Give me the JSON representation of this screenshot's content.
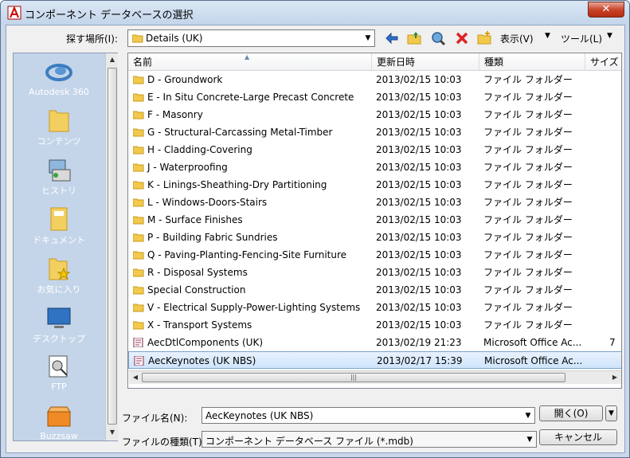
{
  "window": {
    "title": "コンポーネント データベースの選択",
    "close_label": "✕"
  },
  "toolbar": {
    "lookin_label": "探す場所(I):",
    "lookin_value": "Details (UK)",
    "view_label": "表示(V)",
    "tools_label": "ツール(L)",
    "icons": [
      "back-icon",
      "up-folder-icon",
      "search-web-icon",
      "delete-icon",
      "new-folder-icon"
    ]
  },
  "places": [
    {
      "label": "Autodesk 360",
      "icon": "autodesk-360-icon"
    },
    {
      "label": "コンテンツ",
      "icon": "folder-icon"
    },
    {
      "label": "ヒストリ",
      "icon": "history-icon"
    },
    {
      "label": "ドキュメント",
      "icon": "documents-icon"
    },
    {
      "label": "お気に入り",
      "icon": "favorites-icon"
    },
    {
      "label": "デスクトップ",
      "icon": "desktop-icon"
    },
    {
      "label": "FTP",
      "icon": "ftp-icon"
    },
    {
      "label": "Buzzsaw",
      "icon": "buzzsaw-icon"
    }
  ],
  "columns": {
    "name": "名前",
    "date": "更新日時",
    "type": "種類",
    "size": "サイズ"
  },
  "files": [
    {
      "name": "D - Groundwork",
      "date": "2013/02/15 10:03",
      "type": "ファイル フォルダー",
      "size": "",
      "kind": "folder"
    },
    {
      "name": "E - In Situ Concrete-Large Precast Concrete",
      "date": "2013/02/15 10:03",
      "type": "ファイル フォルダー",
      "size": "",
      "kind": "folder"
    },
    {
      "name": "F - Masonry",
      "date": "2013/02/15 10:03",
      "type": "ファイル フォルダー",
      "size": "",
      "kind": "folder"
    },
    {
      "name": "G - Structural-Carcassing Metal-Timber",
      "date": "2013/02/15 10:03",
      "type": "ファイル フォルダー",
      "size": "",
      "kind": "folder"
    },
    {
      "name": "H - Cladding-Covering",
      "date": "2013/02/15 10:03",
      "type": "ファイル フォルダー",
      "size": "",
      "kind": "folder"
    },
    {
      "name": "J - Waterproofing",
      "date": "2013/02/15 10:03",
      "type": "ファイル フォルダー",
      "size": "",
      "kind": "folder"
    },
    {
      "name": "K - Linings-Sheathing-Dry Partitioning",
      "date": "2013/02/15 10:03",
      "type": "ファイル フォルダー",
      "size": "",
      "kind": "folder"
    },
    {
      "name": "L - Windows-Doors-Stairs",
      "date": "2013/02/15 10:03",
      "type": "ファイル フォルダー",
      "size": "",
      "kind": "folder"
    },
    {
      "name": "M - Surface Finishes",
      "date": "2013/02/15 10:03",
      "type": "ファイル フォルダー",
      "size": "",
      "kind": "folder"
    },
    {
      "name": "P - Building Fabric Sundries",
      "date": "2013/02/15 10:03",
      "type": "ファイル フォルダー",
      "size": "",
      "kind": "folder"
    },
    {
      "name": "Q - Paving-Planting-Fencing-Site Furniture",
      "date": "2013/02/15 10:03",
      "type": "ファイル フォルダー",
      "size": "",
      "kind": "folder"
    },
    {
      "name": "R - Disposal Systems",
      "date": "2013/02/15 10:03",
      "type": "ファイル フォルダー",
      "size": "",
      "kind": "folder"
    },
    {
      "name": "Special Construction",
      "date": "2013/02/15 10:03",
      "type": "ファイル フォルダー",
      "size": "",
      "kind": "folder"
    },
    {
      "name": "V - Electrical Supply-Power-Lighting Systems",
      "date": "2013/02/15 10:03",
      "type": "ファイル フォルダー",
      "size": "",
      "kind": "folder"
    },
    {
      "name": "X - Transport Systems",
      "date": "2013/02/15 10:03",
      "type": "ファイル フォルダー",
      "size": "",
      "kind": "folder"
    },
    {
      "name": "AecDtlComponents (UK)",
      "date": "2013/02/19 21:23",
      "type": "Microsoft Office Ac...",
      "size": "7",
      "kind": "mdb"
    },
    {
      "name": "AecKeynotes (UK NBS)",
      "date": "2013/02/17 15:39",
      "type": "Microsoft Office Ac...",
      "size": "",
      "kind": "mdb",
      "selected": true
    }
  ],
  "filename": {
    "label": "ファイル名(N):",
    "value": "AecKeynotes (UK NBS)"
  },
  "filetype": {
    "label": "ファイルの種類(T):",
    "value": "コンポーネント データベース ファイル (*.mdb)"
  },
  "buttons": {
    "open": "開く(O)",
    "cancel": "キャンセル"
  },
  "colors": {
    "places_bg": "#c4d5e9",
    "selection": "#cfe4fb",
    "close": "#c9462c"
  }
}
